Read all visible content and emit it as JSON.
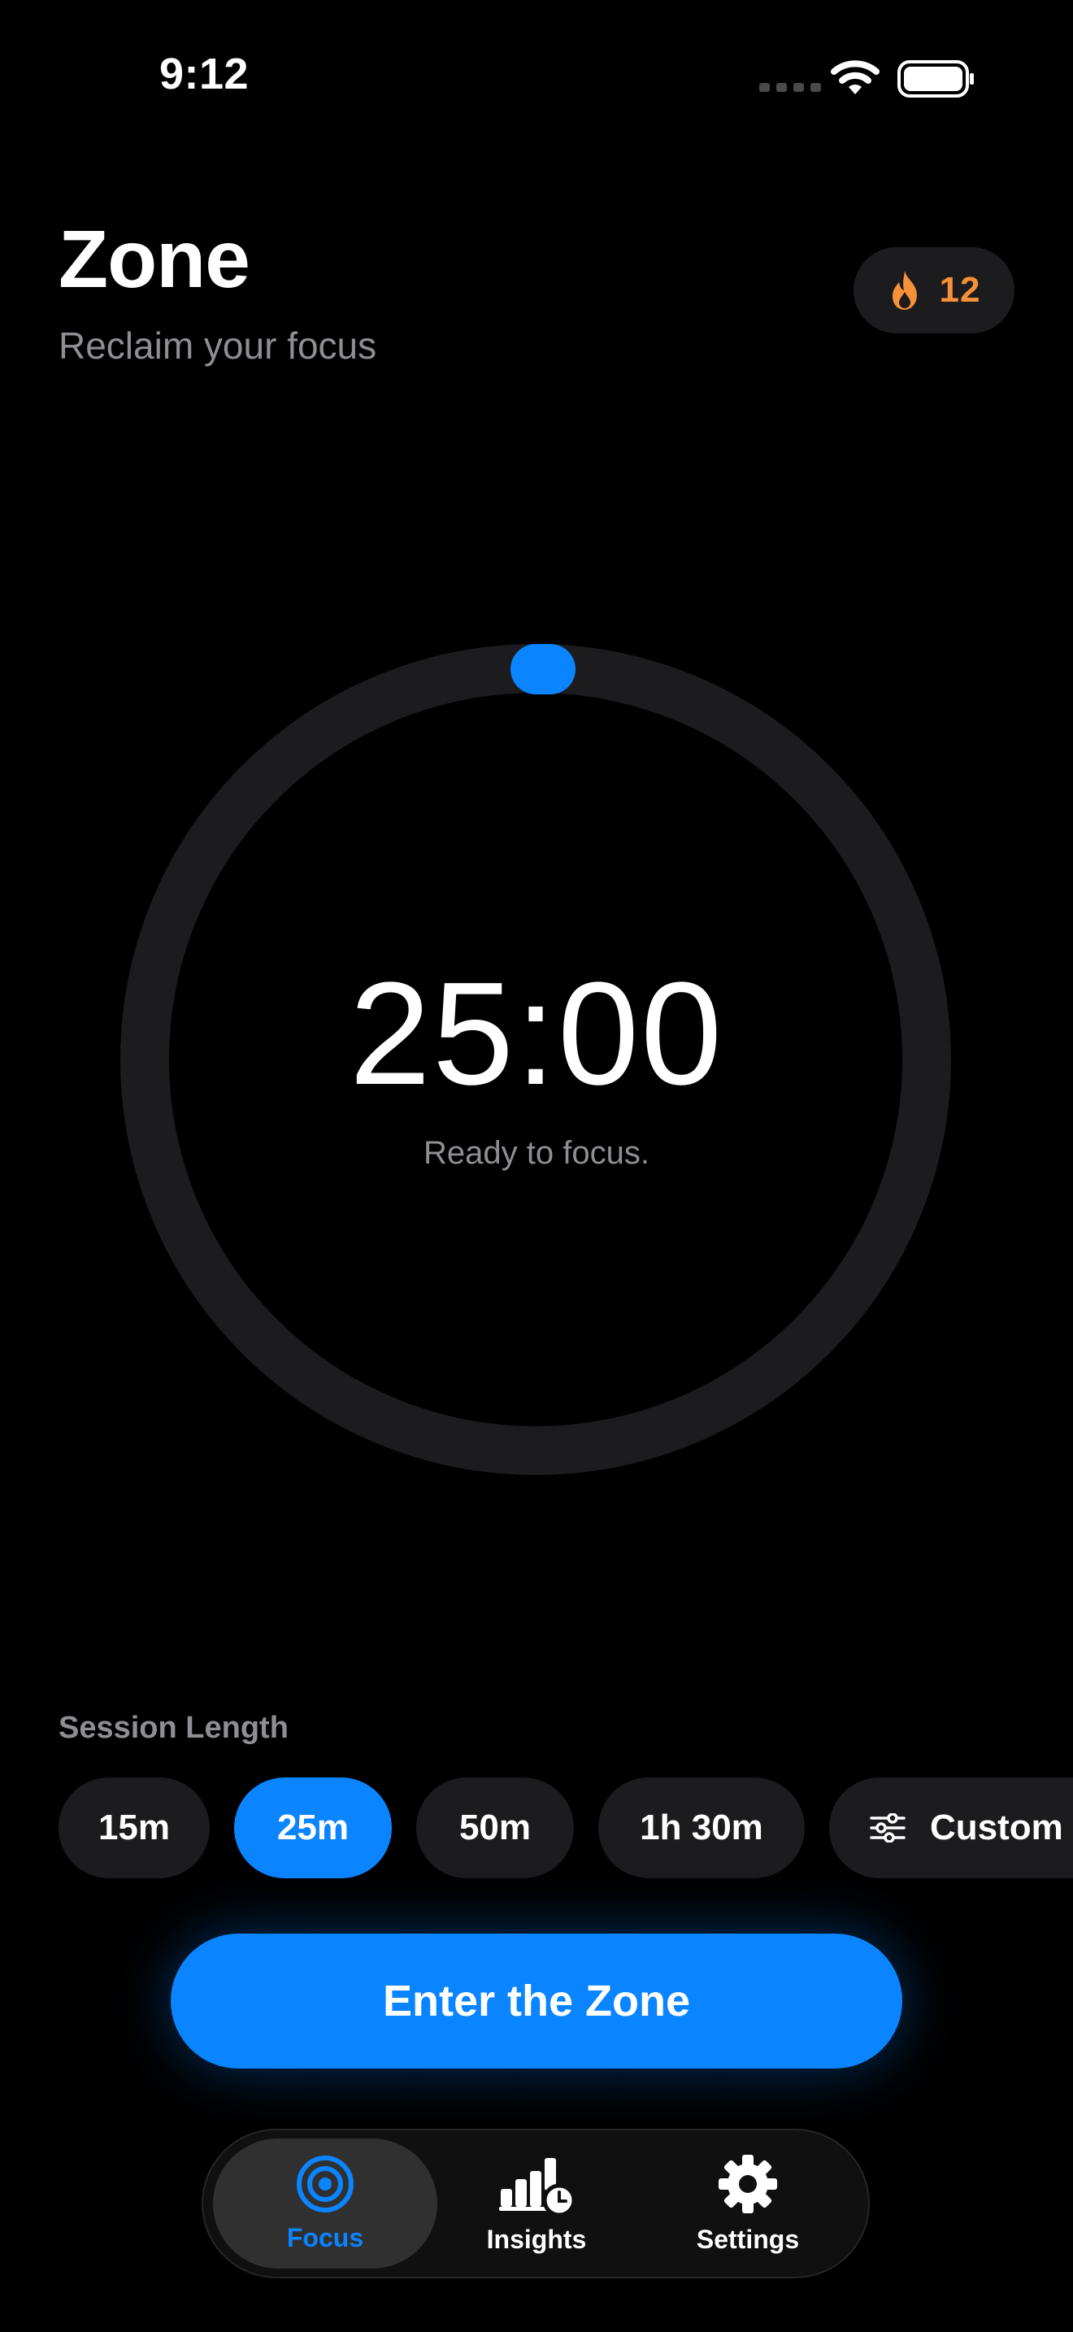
{
  "status_bar": {
    "time": "9:12"
  },
  "header": {
    "title": "Zone",
    "subtitle": "Reclaim your focus"
  },
  "streak": {
    "count": "12",
    "icon": "flame-icon",
    "color": "#f6913a"
  },
  "timer": {
    "display": "25:00",
    "status": "Ready to focus."
  },
  "session": {
    "label": "Session Length",
    "options": [
      {
        "label": "15m",
        "selected": false
      },
      {
        "label": "25m",
        "selected": true
      },
      {
        "label": "50m",
        "selected": false
      },
      {
        "label": "1h 30m",
        "selected": false
      },
      {
        "label": "Custom",
        "selected": false,
        "icon": "sliders-icon"
      }
    ]
  },
  "cta": {
    "label": "Enter the Zone"
  },
  "tabs": [
    {
      "label": "Focus",
      "icon": "target-icon",
      "active": true
    },
    {
      "label": "Insights",
      "icon": "chart-clock-icon",
      "active": false
    },
    {
      "label": "Settings",
      "icon": "gear-icon",
      "active": false
    }
  ],
  "colors": {
    "accent": "#0a84ff",
    "background": "#000000",
    "surface": "#1c1c1e",
    "secondary_text": "#8e8e93"
  }
}
